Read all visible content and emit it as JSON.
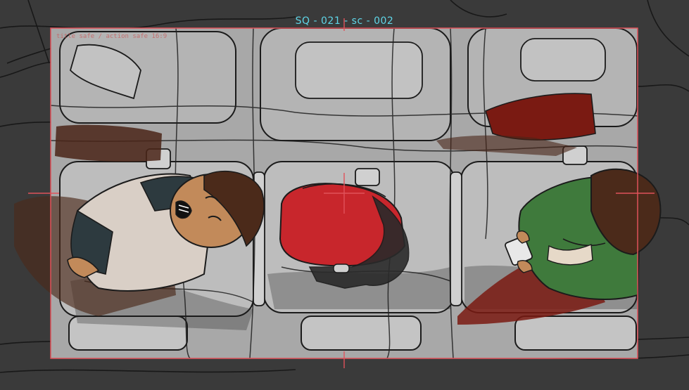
{
  "frame": {
    "scene_label": "SQ - 021 - sc - 002",
    "safe_area_label": "title safe / action safe 16:9"
  },
  "colors": {
    "background": "#3a3a3a",
    "cabin_floor": "#a9a9a9",
    "seat_fill": "#bdbdbd",
    "ink": "#1c1c1c",
    "guide_red": "#e0525a",
    "label_cyan": "#5fd6e8",
    "blanket_red": "#7a1a12",
    "bag_red": "#c8262c",
    "skin_tan": "#c28a5a",
    "jacket_green": "#3f7a3c",
    "hair_brown": "#4b2a1a"
  },
  "icons": [
    "crosshair-marker"
  ]
}
